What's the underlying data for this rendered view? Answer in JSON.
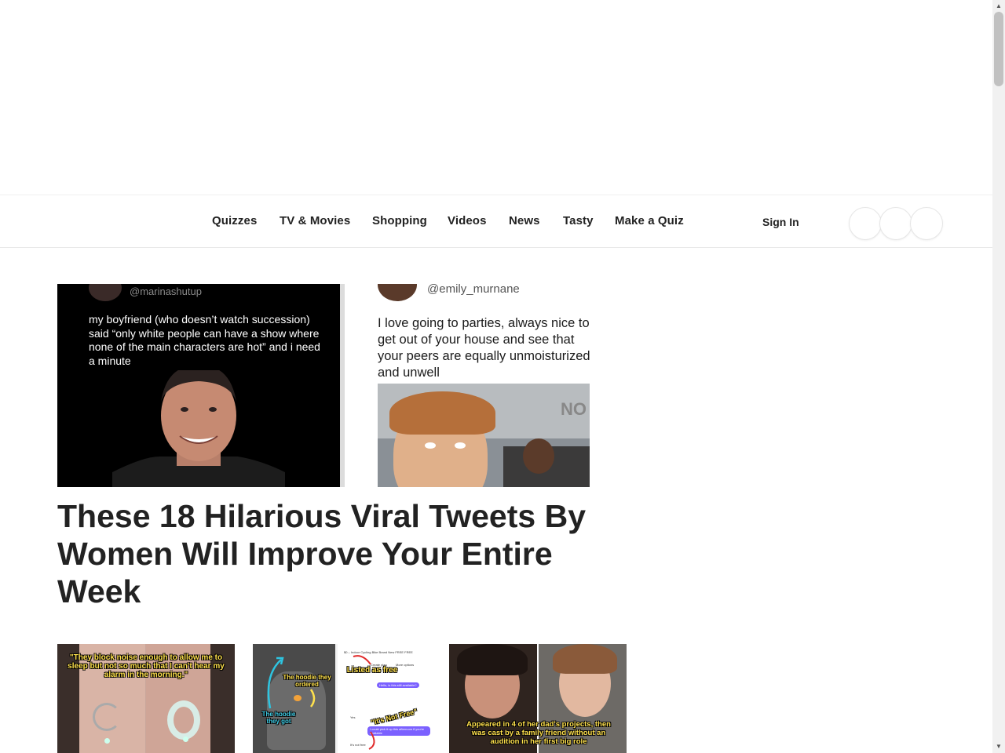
{
  "nav": {
    "items": [
      "Quizzes",
      "TV & Movies",
      "Shopping",
      "Videos",
      "News",
      "Tasty",
      "Make a Quiz"
    ],
    "sign_in": "Sign In"
  },
  "hero": {
    "left_tweet": {
      "handle": "@marinashutup",
      "text": "my boyfriend (who doesn’t watch succession) said “only white people can have a show where none of the main characters are hot” and i need a minute"
    },
    "right_tweet": {
      "handle": "@emily_murnane",
      "text": "I love going to parties, always nice to get out of your house and see that your peers are equally unmoisturized and unwell"
    },
    "headline": "These 18 Hilarious Viral Tweets By Women Will Improve Your Entire Week"
  },
  "thumbs": [
    {
      "caption": "\"They block noise enough to allow me to sleep but not so much that I can't hear my alarm in the morning.\""
    },
    {
      "caption_top": "The hoodie they ordered",
      "caption_mid": "Listed as free",
      "caption_bottom": "The hoodie they got",
      "caption_red": "\"It's Not Free\"",
      "chat_header": "$0 – Indoor Cycling Bike Brand New FREE FREE",
      "chat_btn1": "Create plan",
      "chat_btn2": "More options",
      "chat_msg1": "Hello, is this still available?",
      "chat_msg2": "Yes",
      "chat_msg3": "I could pick it up this afternoon if you're available",
      "chat_msg4": "It's not free"
    },
    {
      "caption": "Appeared in 4 of her dad's projects, then was cast by a family friend without an audition in her first big role"
    }
  ],
  "colors": {
    "caption_yellow": "#ffe14d",
    "chat_purple": "#7b61ff",
    "arrow_red": "#e02b2b",
    "arrow_teal": "#2ec4e0"
  }
}
